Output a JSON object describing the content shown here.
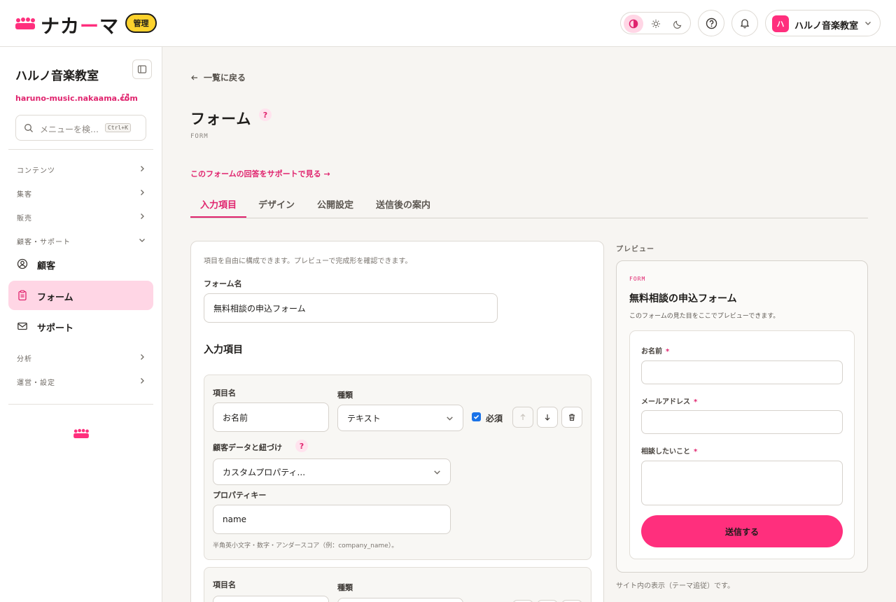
{
  "header": {
    "brand_left": "ナカ",
    "brand_dash": "ー",
    "brand_right": "マ",
    "admin_badge": "管理",
    "account_avatar": "ハ",
    "account_name": "ハルノ音楽教室",
    "icons": [
      "theme-contrast-icon",
      "sun-icon",
      "moon-icon",
      "help-icon",
      "bell-icon",
      "chevron-down-icon"
    ]
  },
  "sidebar": {
    "site_name": "ハルノ音楽教室",
    "site_url": "haruno-music.nakaama.com",
    "search_placeholder": "メニューを検…",
    "search_shortcut": "Ctrl+K",
    "groups": {
      "contents": "コンテンツ",
      "acquisition": "集客",
      "sales": "販売",
      "customer_support": "顧客・サポート",
      "analytics": "分析",
      "operations": "運営・設定"
    },
    "items": {
      "customers": "顧客",
      "forms": "フォーム",
      "support": "サポート"
    }
  },
  "main": {
    "back_link": "一覧に戻る",
    "title": "フォーム",
    "subtitle": "FORM",
    "support_link": "このフォームの回答をサポートで見る →",
    "tabs": {
      "fields": "入力項目",
      "design": "デザイン",
      "publish": "公開設定",
      "after_submit": "送信後の案内"
    },
    "editor": {
      "intro": "項目を自由に構成できます。プレビューで完成形を確認できます。",
      "form_name_label": "フォーム名",
      "form_name_value": "無料相談の申込フォーム",
      "fields_heading": "入力項目",
      "field1": {
        "name_label": "項目名",
        "name_value": "お名前",
        "type_label": "種類",
        "type_value": "テキスト",
        "required_label": "必須",
        "required": true,
        "link_label": "顧客データと紐づけ",
        "link_value": "カスタムプロパティ...",
        "key_label": "プロパティキー",
        "key_value": "name",
        "key_hint": "半角英小文字・数字・アンダースコア（例：company_name）。"
      },
      "field2": {
        "name_label": "項目名",
        "type_label": "種類"
      }
    }
  },
  "preview": {
    "label": "プレビュー",
    "eyebrow": "FORM",
    "title": "無料相談の申込フォーム",
    "description": "このフォームの見た目をここでプレビューできます。",
    "fields": {
      "name": "お名前",
      "email": "メールアドレス",
      "consult": "相談したいこと"
    },
    "required_mark": "*",
    "submit": "送信する",
    "note": "サイト内の表示（テーマ追従）です。"
  },
  "colors": {
    "accent": "#ff2f7d",
    "accent_text": "#e0246e",
    "badge": "#fcd22d",
    "active_bg": "#ffd6e5"
  }
}
